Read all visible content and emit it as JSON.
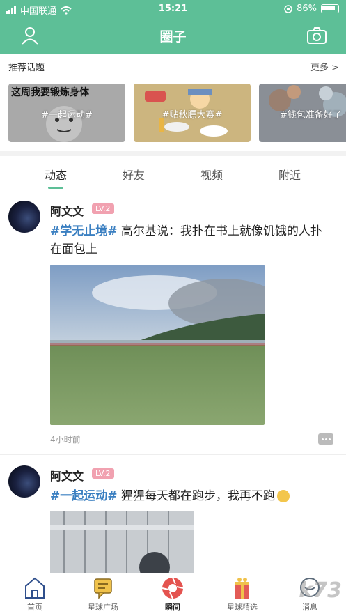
{
  "status_bar": {
    "carrier": "中国联通",
    "time": "15:21",
    "battery": "86%"
  },
  "navbar": {
    "title": "圈子",
    "left_icon": "user-icon",
    "right_icon": "camera-icon"
  },
  "recommended": {
    "heading": "推荐话题",
    "more": "更多 >",
    "topics": [
      {
        "label": "#一起运动#",
        "image_text": "这周我要锻炼身体"
      },
      {
        "label": "#贴秋膘大赛#",
        "image_text": ""
      },
      {
        "label": "#钱包准备好了",
        "image_text": ""
      }
    ]
  },
  "tabs": [
    {
      "label": "动态",
      "active": true
    },
    {
      "label": "好友",
      "active": false
    },
    {
      "label": "视频",
      "active": false
    },
    {
      "label": "附近",
      "active": false
    }
  ],
  "posts": [
    {
      "user": "阿文文",
      "level": "LV.2",
      "tag": "#学无止境#",
      "text": " 高尔基说：我扑在书上就像饥饿的人扑在面包上",
      "time": "4小时前"
    },
    {
      "user": "阿文文",
      "level": "LV.2",
      "tag": "#一起运动#",
      "text": " 猩猩每天都在跑步，我再不跑",
      "time": ""
    }
  ],
  "bottom_nav": [
    {
      "label": "首页",
      "icon": "home-icon",
      "active": false
    },
    {
      "label": "星球广场",
      "icon": "message-icon",
      "active": false
    },
    {
      "label": "瞬间",
      "icon": "camera-shutter-icon",
      "active": true
    },
    {
      "label": "星球精选",
      "icon": "gift-icon",
      "active": false
    },
    {
      "label": "消息",
      "icon": "chat-icon",
      "active": false
    }
  ],
  "watermark": "k73"
}
